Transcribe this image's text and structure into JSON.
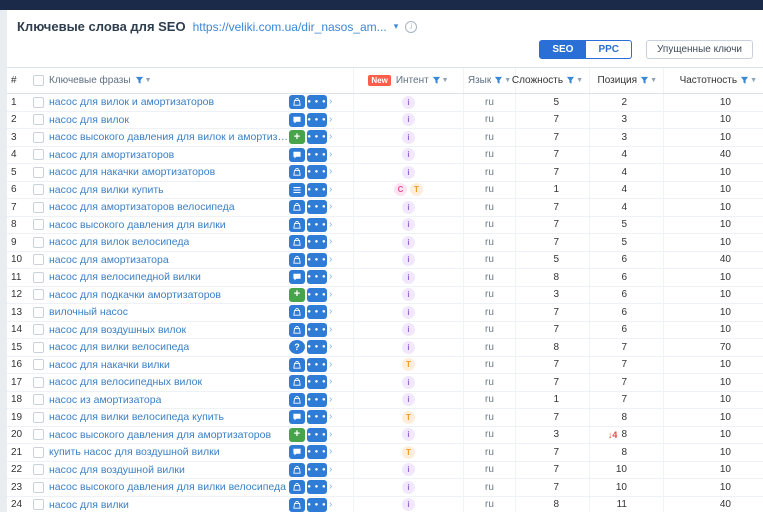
{
  "page": {
    "title": "Ключевые слова для SEO",
    "url": "https://veliki.com.ua/dir_nasos_am... ",
    "tabs": {
      "seo": "SEO",
      "ppc": "PPC"
    },
    "missed_keys_button": "Упущенные ключи"
  },
  "colors": {
    "accent_blue": "#2a6fd6",
    "link_blue": "#3a7fc4",
    "badge_blue": "#2e7cd6",
    "badge_green": "#47a44b",
    "new_badge_red": "#ff5e49",
    "intent_i_bg": "#f1e8fb",
    "intent_i_fg": "#9a63d8",
    "intent_c_bg": "#fce4f0",
    "intent_c_fg": "#e0559a",
    "intent_t_bg": "#fdeedc",
    "intent_t_fg": "#ef9b2d",
    "position_drop_red": "#e5493a"
  },
  "table": {
    "headers": {
      "num": "#",
      "keyword": "Ключевые фразы",
      "new_badge": "New",
      "intent": "Интент",
      "lang": "Язык",
      "difficulty": "Сложность",
      "position": "Позиция",
      "frequency": "Частотность"
    },
    "rows": [
      {
        "num": 1,
        "keyword": "насос для вилок и амортизаторов",
        "icon": "shopping-bag",
        "intents": [
          "i"
        ],
        "lang": "ru",
        "difficulty": 5,
        "position": 2,
        "frequency": 10
      },
      {
        "num": 2,
        "keyword": "насос для вилок",
        "icon": "chat-bubble",
        "intents": [
          "i"
        ],
        "lang": "ru",
        "difficulty": 7,
        "position": 3,
        "frequency": 10
      },
      {
        "num": 3,
        "keyword": "насос высокого давления для вилок и амортизаторов",
        "icon": "plus",
        "intents": [
          "i"
        ],
        "lang": "ru",
        "difficulty": 7,
        "position": 3,
        "frequency": 10
      },
      {
        "num": 4,
        "keyword": "насос для амортизаторов",
        "icon": "chat-bubble",
        "intents": [
          "i"
        ],
        "lang": "ru",
        "difficulty": 7,
        "position": 4,
        "frequency": 40
      },
      {
        "num": 5,
        "keyword": "насос для накачки амортизаторов",
        "icon": "shopping-bag",
        "intents": [
          "i"
        ],
        "lang": "ru",
        "difficulty": 7,
        "position": 4,
        "frequency": 10
      },
      {
        "num": 6,
        "keyword": "насос для вилки купить",
        "icon": "list",
        "intents": [
          "C",
          "T"
        ],
        "lang": "ru",
        "difficulty": 1,
        "position": 4,
        "frequency": 10
      },
      {
        "num": 7,
        "keyword": "насос для амортизаторов велосипеда",
        "icon": "shopping-bag",
        "intents": [
          "i"
        ],
        "lang": "ru",
        "difficulty": 7,
        "position": 4,
        "frequency": 10
      },
      {
        "num": 8,
        "keyword": "насос высокого давления для вилки",
        "icon": "shopping-bag",
        "intents": [
          "i"
        ],
        "lang": "ru",
        "difficulty": 7,
        "position": 5,
        "frequency": 10
      },
      {
        "num": 9,
        "keyword": "насос для вилок велосипеда",
        "icon": "shopping-bag",
        "intents": [
          "i"
        ],
        "lang": "ru",
        "difficulty": 7,
        "position": 5,
        "frequency": 10
      },
      {
        "num": 10,
        "keyword": "насос для амортизатора",
        "icon": "shopping-bag",
        "intents": [
          "i"
        ],
        "lang": "ru",
        "difficulty": 5,
        "position": 6,
        "frequency": 40
      },
      {
        "num": 11,
        "keyword": "насос для велосипедной вилки",
        "icon": "chat-bubble",
        "intents": [
          "i"
        ],
        "lang": "ru",
        "difficulty": 8,
        "position": 6,
        "frequency": 10
      },
      {
        "num": 12,
        "keyword": "насос для подкачки амортизаторов",
        "icon": "plus",
        "intents": [
          "i"
        ],
        "lang": "ru",
        "difficulty": 3,
        "position": 6,
        "frequency": 10
      },
      {
        "num": 13,
        "keyword": "вилочный насос",
        "icon": "shopping-bag",
        "intents": [
          "i"
        ],
        "lang": "ru",
        "difficulty": 7,
        "position": 6,
        "frequency": 10
      },
      {
        "num": 14,
        "keyword": "насос для воздушных вилок",
        "icon": "shopping-bag",
        "intents": [
          "i"
        ],
        "lang": "ru",
        "difficulty": 7,
        "position": 6,
        "frequency": 10
      },
      {
        "num": 15,
        "keyword": "насос для вилки велосипеда",
        "icon": "question",
        "intents": [
          "i"
        ],
        "lang": "ru",
        "difficulty": 8,
        "position": 7,
        "frequency": 70
      },
      {
        "num": 16,
        "keyword": "насос для накачки вилки",
        "icon": "shopping-bag",
        "intents": [
          "T"
        ],
        "lang": "ru",
        "difficulty": 7,
        "position": 7,
        "frequency": 10
      },
      {
        "num": 17,
        "keyword": "насос для велосипедных вилок",
        "icon": "shopping-bag",
        "intents": [
          "i"
        ],
        "lang": "ru",
        "difficulty": 7,
        "position": 7,
        "frequency": 10
      },
      {
        "num": 18,
        "keyword": "насос из амортизатора",
        "icon": "shopping-bag",
        "intents": [
          "i"
        ],
        "lang": "ru",
        "difficulty": 1,
        "position": 7,
        "frequency": 10
      },
      {
        "num": 19,
        "keyword": "насос для вилки велосипеда купить",
        "icon": "chat-bubble",
        "intents": [
          "T"
        ],
        "lang": "ru",
        "difficulty": 7,
        "position": 8,
        "frequency": 10
      },
      {
        "num": 20,
        "keyword": "насос высокого давления для амортизаторов",
        "icon": "plus",
        "intents": [
          "i"
        ],
        "lang": "ru",
        "difficulty": 3,
        "pos_change": "↓4",
        "position": 8,
        "frequency": 10
      },
      {
        "num": 21,
        "keyword": "купить насос для воздушной вилки",
        "icon": "chat-bubble",
        "intents": [
          "T"
        ],
        "lang": "ru",
        "difficulty": 7,
        "position": 8,
        "frequency": 10
      },
      {
        "num": 22,
        "keyword": "насос для воздушной вилки",
        "icon": "shopping-bag",
        "intents": [
          "i"
        ],
        "lang": "ru",
        "difficulty": 7,
        "position": 10,
        "frequency": 10
      },
      {
        "num": 23,
        "keyword": "насос высокого давления для вилки велосипеда",
        "icon": "shopping-bag",
        "intents": [
          "i"
        ],
        "lang": "ru",
        "difficulty": 7,
        "position": 10,
        "frequency": 10
      },
      {
        "num": 24,
        "keyword": "насос для вилки",
        "icon": "shopping-bag",
        "intents": [
          "i"
        ],
        "lang": "ru",
        "difficulty": 8,
        "position": 11,
        "frequency": 40
      }
    ]
  }
}
